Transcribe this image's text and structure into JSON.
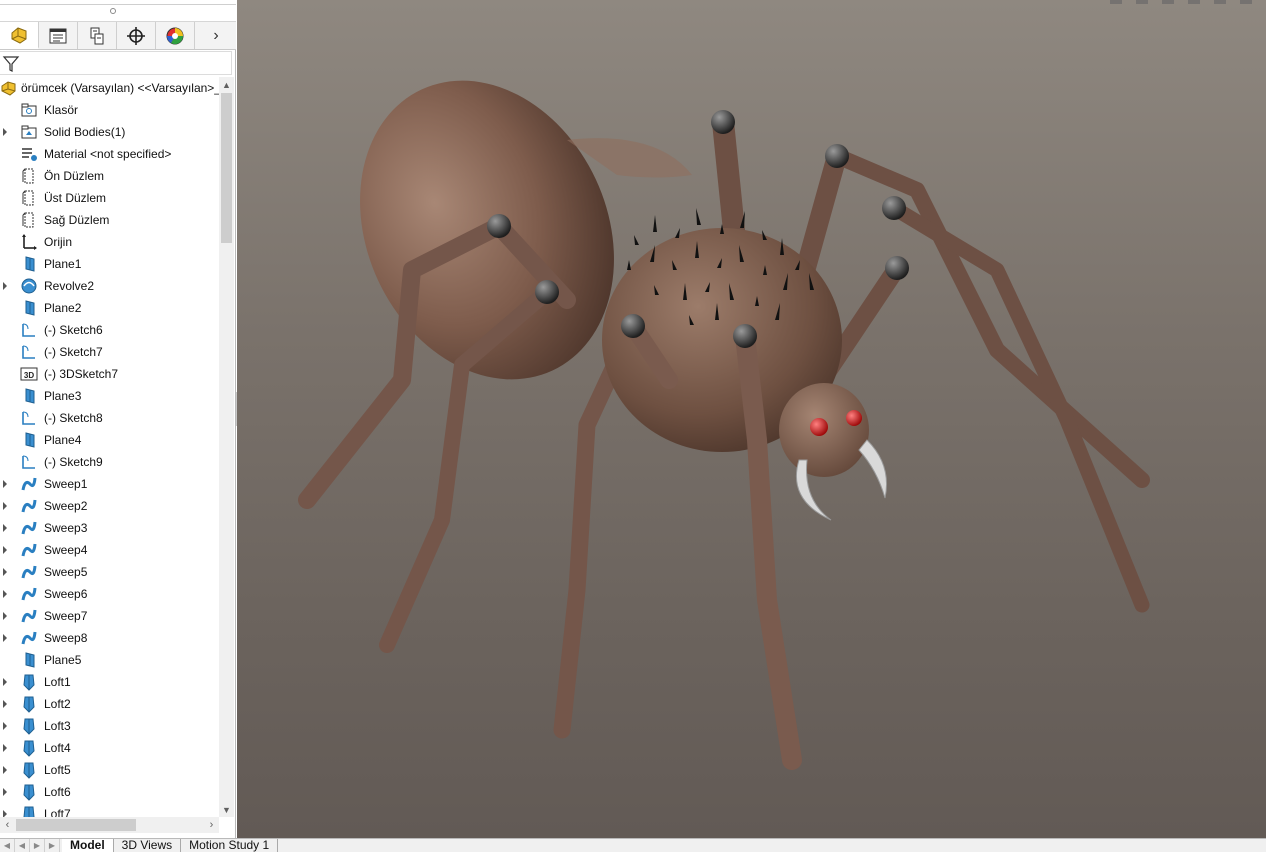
{
  "tree": {
    "root_label": "örümcek (Varsayılan) <<Varsayılan>_",
    "items": [
      {
        "label": "Klasör",
        "icon": "folder-icon",
        "expandable": false
      },
      {
        "label": "Solid Bodies(1)",
        "icon": "solid-bodies-icon",
        "expandable": true
      },
      {
        "label": "Material <not specified>",
        "icon": "material-icon",
        "expandable": false
      },
      {
        "label": "Ön Düzlem",
        "icon": "plane-icon",
        "expandable": false
      },
      {
        "label": "Üst Düzlem",
        "icon": "plane-icon",
        "expandable": false
      },
      {
        "label": "Sağ Düzlem",
        "icon": "plane-icon",
        "expandable": false
      },
      {
        "label": "Orijin",
        "icon": "origin-icon",
        "expandable": false
      },
      {
        "label": "Plane1",
        "icon": "ref-plane-icon",
        "expandable": false
      },
      {
        "label": "Revolve2",
        "icon": "revolve-icon",
        "expandable": true
      },
      {
        "label": "Plane2",
        "icon": "ref-plane-icon",
        "expandable": false
      },
      {
        "label": "(-) Sketch6",
        "icon": "sketch-icon",
        "expandable": false
      },
      {
        "label": "(-) Sketch7",
        "icon": "sketch-icon",
        "expandable": false
      },
      {
        "label": "(-) 3DSketch7",
        "icon": "sketch-3d-icon",
        "expandable": false
      },
      {
        "label": "Plane3",
        "icon": "ref-plane-icon",
        "expandable": false
      },
      {
        "label": "(-) Sketch8",
        "icon": "sketch-icon",
        "expandable": false
      },
      {
        "label": "Plane4",
        "icon": "ref-plane-icon",
        "expandable": false
      },
      {
        "label": "(-) Sketch9",
        "icon": "sketch-icon",
        "expandable": false
      },
      {
        "label": "Sweep1",
        "icon": "sweep-icon",
        "expandable": true
      },
      {
        "label": "Sweep2",
        "icon": "sweep-icon",
        "expandable": true
      },
      {
        "label": "Sweep3",
        "icon": "sweep-icon",
        "expandable": true
      },
      {
        "label": "Sweep4",
        "icon": "sweep-icon",
        "expandable": true
      },
      {
        "label": "Sweep5",
        "icon": "sweep-icon",
        "expandable": true
      },
      {
        "label": "Sweep6",
        "icon": "sweep-icon",
        "expandable": true
      },
      {
        "label": "Sweep7",
        "icon": "sweep-icon",
        "expandable": true
      },
      {
        "label": "Sweep8",
        "icon": "sweep-icon",
        "expandable": true
      },
      {
        "label": "Plane5",
        "icon": "ref-plane-icon",
        "expandable": false
      },
      {
        "label": "Loft1",
        "icon": "loft-icon",
        "expandable": true
      },
      {
        "label": "Loft2",
        "icon": "loft-icon",
        "expandable": true
      },
      {
        "label": "Loft3",
        "icon": "loft-icon",
        "expandable": true
      },
      {
        "label": "Loft4",
        "icon": "loft-icon",
        "expandable": true
      },
      {
        "label": "Loft5",
        "icon": "loft-icon",
        "expandable": true
      },
      {
        "label": "Loft6",
        "icon": "loft-icon",
        "expandable": true
      },
      {
        "label": "Loft7",
        "icon": "loft-icon",
        "expandable": true
      }
    ]
  },
  "panel_tabs": [
    {
      "icon": "feature-manager-icon",
      "active": true
    },
    {
      "icon": "property-manager-icon",
      "active": false
    },
    {
      "icon": "configuration-manager-icon",
      "active": false
    },
    {
      "icon": "dimxpert-icon",
      "active": false
    },
    {
      "icon": "display-manager-icon",
      "active": false
    }
  ],
  "bottom_tabs": [
    {
      "label": "Model",
      "active": true
    },
    {
      "label": "3D Views",
      "active": false
    },
    {
      "label": "Motion Study 1",
      "active": false
    }
  ],
  "colors": {
    "accent_blue": "#2a7fc1",
    "spider_body": "#7a5a4c",
    "eyes": "#c81010"
  }
}
